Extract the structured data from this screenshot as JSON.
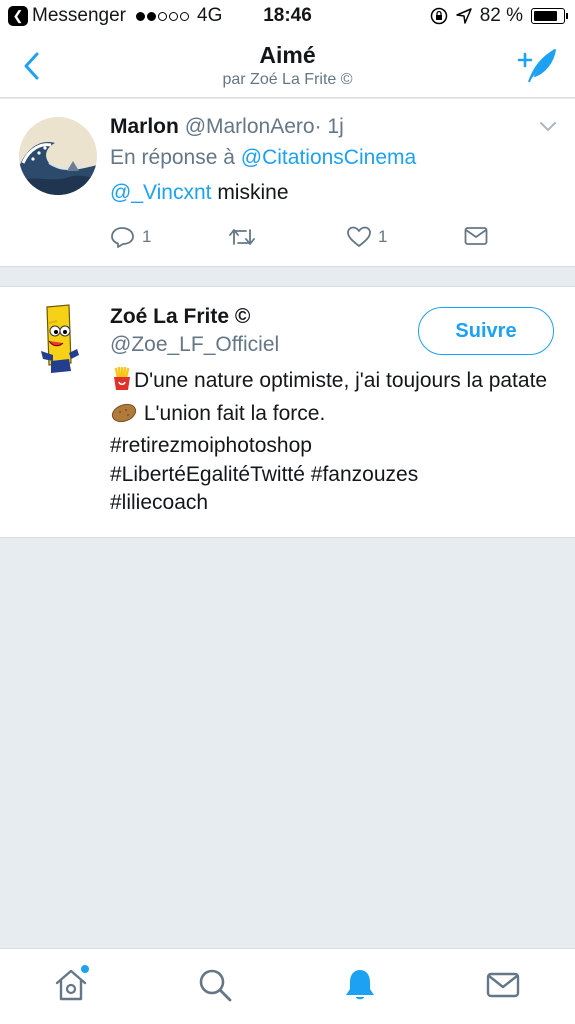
{
  "status_bar": {
    "back_app": "Messenger",
    "carrier": "4G",
    "time": "18:46",
    "battery_percent": "82 %",
    "battery_level": 0.82,
    "signal_dots_filled": 2,
    "signal_dots_total": 5
  },
  "nav": {
    "title": "Aimé",
    "subtitle": "par Zoé La Frite ©",
    "back_icon": "chevron-left-icon",
    "compose_icon": "compose-feather-icon"
  },
  "tweet": {
    "author_name": "Marlon",
    "author_handle": "@MarlonAero",
    "separator": "·",
    "time": "1j",
    "reply_prefix": "En réponse à",
    "reply_to": "@CitationsCinema",
    "mention": "@_Vincxnt",
    "text": " miskine",
    "actions": {
      "reply_count": "1",
      "retweet_count": "",
      "like_count": "1"
    }
  },
  "profile": {
    "name": "Zoé La Frite ©",
    "handle": "@Zoe_LF_Officiel",
    "follow_label": "Suivre",
    "bio_emoji_1": "🍟",
    "bio_part_1": "D'une nature optimiste, j'ai toujours la patate",
    "bio_emoji_2": "🥔",
    "bio_part_2": " L'union fait la force.",
    "hashtag_1": "#retirezmoiphotoshop",
    "hashtag_2": "#LibertéEgalitéTwitté",
    "hashtag_3": "#fanzouzes",
    "hashtag_4": "#liliecoach"
  },
  "tabbar": {
    "tabs": [
      {
        "icon": "home-icon",
        "active": false,
        "has_notification_dot": true
      },
      {
        "icon": "search-icon",
        "active": false
      },
      {
        "icon": "bell-icon",
        "active": true
      },
      {
        "icon": "mail-icon",
        "active": false
      }
    ]
  },
  "colors": {
    "accent": "#1da1f2",
    "text": "#14171a",
    "secondary_text": "#657786",
    "background": "#e6ecf0"
  }
}
